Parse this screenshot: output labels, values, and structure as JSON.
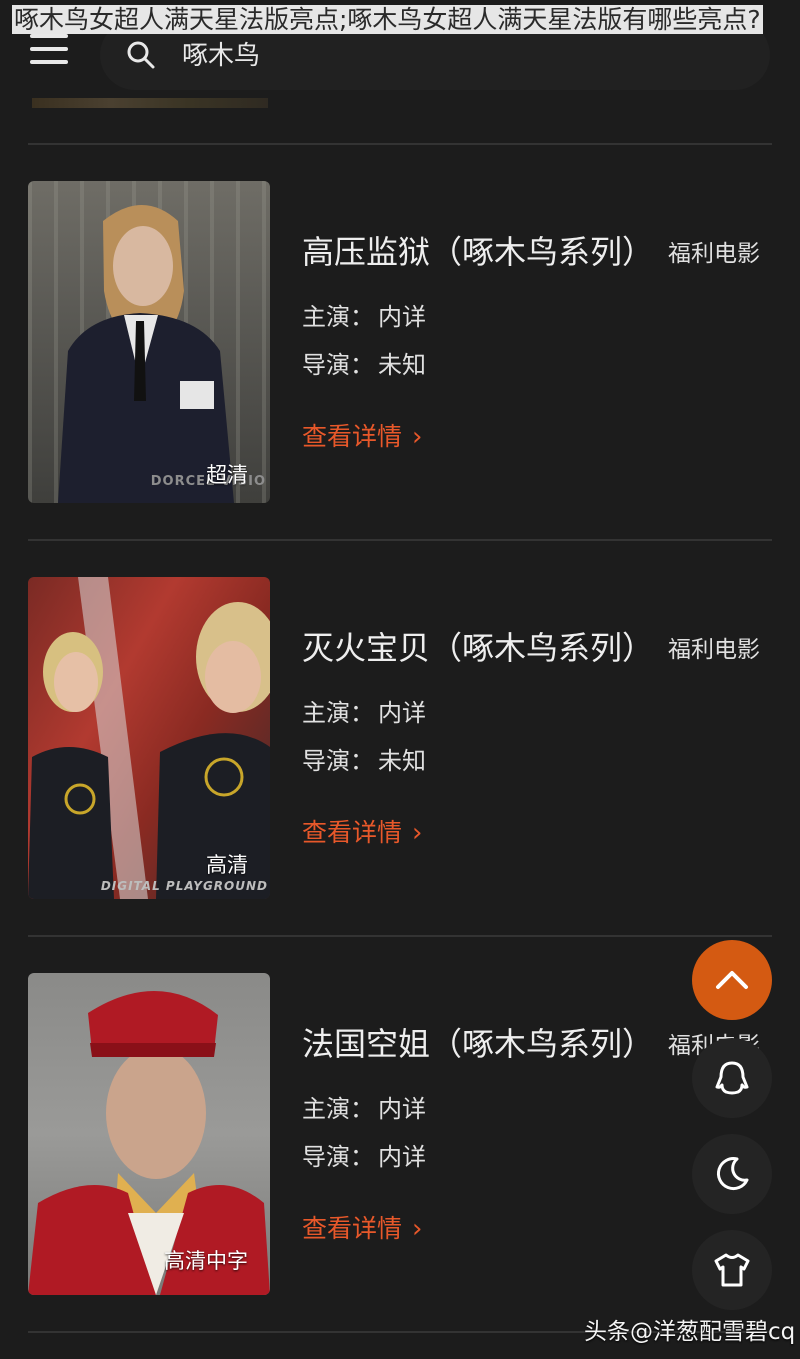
{
  "title_overlay": "啄木鸟女超人满天星法版亮点;啄木鸟女超人满天星法版有哪些亮点?",
  "search": {
    "value": "啄木鸟"
  },
  "items": [
    {
      "title": "高压监狱（啄木鸟系列）",
      "category": "福利电影",
      "cast_label": "主演：",
      "cast": "内详",
      "director_label": "导演：",
      "director": "未知",
      "detail_label": "查看详情",
      "badge": "超清",
      "thumb_watermark": "DORCEL VISIO"
    },
    {
      "title": "灭火宝贝（啄木鸟系列）",
      "category": "福利电影",
      "cast_label": "主演：",
      "cast": "内详",
      "director_label": "导演：",
      "director": "未知",
      "detail_label": "查看详情",
      "badge": "高清",
      "thumb_watermark": "DIGITAL PLAYGROUND"
    },
    {
      "title": "法国空姐（啄木鸟系列）",
      "category": "福利电影",
      "cast_label": "主演：",
      "cast": "内详",
      "director_label": "导演：",
      "director": "内详",
      "detail_label": "查看详情",
      "badge": "高清中字"
    }
  ],
  "floating_buttons": [
    "chevron-up-icon",
    "qq-icon",
    "moon-icon",
    "tshirt-icon"
  ],
  "watermark": "头条@洋葱配雪碧cq",
  "colors": {
    "background": "#1c1c1c",
    "accent": "#e8582a",
    "fab_up": "#d45a12"
  }
}
